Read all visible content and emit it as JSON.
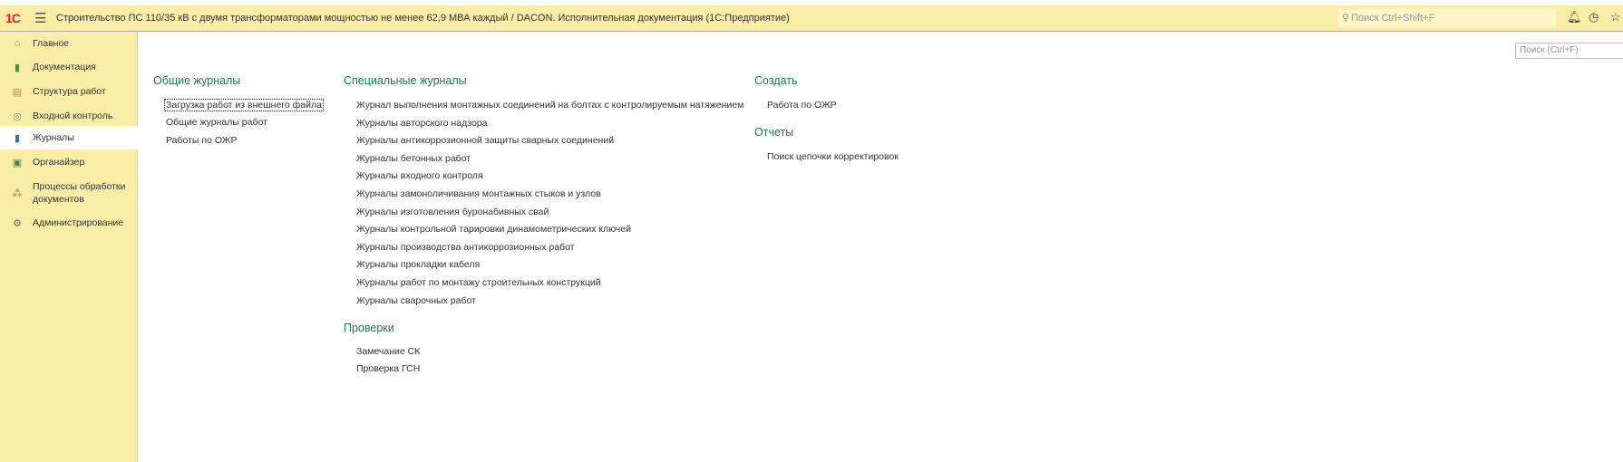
{
  "topbar": {
    "logo": "1С",
    "title": "Строительство ПС 110/35 кВ с двумя трансформаторами мощностью не менее 62,9 МВА каждый / DACON. Исполнительная документация  (1С:Предприятие)",
    "search_placeholder": "Поиск Ctrl+Shift+F"
  },
  "sidebar": {
    "items": [
      {
        "label": "Главное",
        "icon": "home-icon"
      },
      {
        "label": "Документация",
        "icon": "document-icon"
      },
      {
        "label": "Структура работ",
        "icon": "structure-icon"
      },
      {
        "label": "Входной контроль",
        "icon": "control-icon"
      },
      {
        "label": "Журналы",
        "icon": "journal-icon",
        "selected": true
      },
      {
        "label": "Органайзер",
        "icon": "organizer-icon"
      },
      {
        "label": "Процессы обработки документов",
        "icon": "process-icon"
      },
      {
        "label": "Администрирование",
        "icon": "gear-icon"
      }
    ]
  },
  "main": {
    "search_placeholder": "Поиск (Ctrl+F)",
    "general": {
      "title": "Общие журналы",
      "items": [
        "Загрузка работ из внешнего файла",
        "Общие журналы работ",
        "Работы по ОЖР"
      ]
    },
    "special": {
      "title": "Специальные журналы",
      "items": [
        "Журнал выполнения монтажных соединений на болтах с контролируемым натяжением",
        "Журналы авторского надзора",
        "Журналы антикоррозионной защиты сварных соединений",
        "Журналы бетонных работ",
        "Журналы входного контроля",
        "Журналы замоноличивания монтажных стыков и узлов",
        "Журналы изготовления буронабивных свай",
        "Журналы контрольной тарировки динамометрических ключей",
        "Журналы производства антикоррозионных работ",
        "Журналы прокладки кабеля",
        "Журналы работ по монтажу строительных конструкций",
        "Журналы сварочных работ"
      ]
    },
    "checks": {
      "title": "Проверки",
      "items": [
        "Замечание СК",
        "Проверка ГСН"
      ]
    },
    "create": {
      "title": "Создать",
      "items": [
        "Работа по ОЖР"
      ]
    },
    "reports": {
      "title": "Отчеты",
      "items": [
        "Поиск цепочки корректировок"
      ]
    }
  }
}
